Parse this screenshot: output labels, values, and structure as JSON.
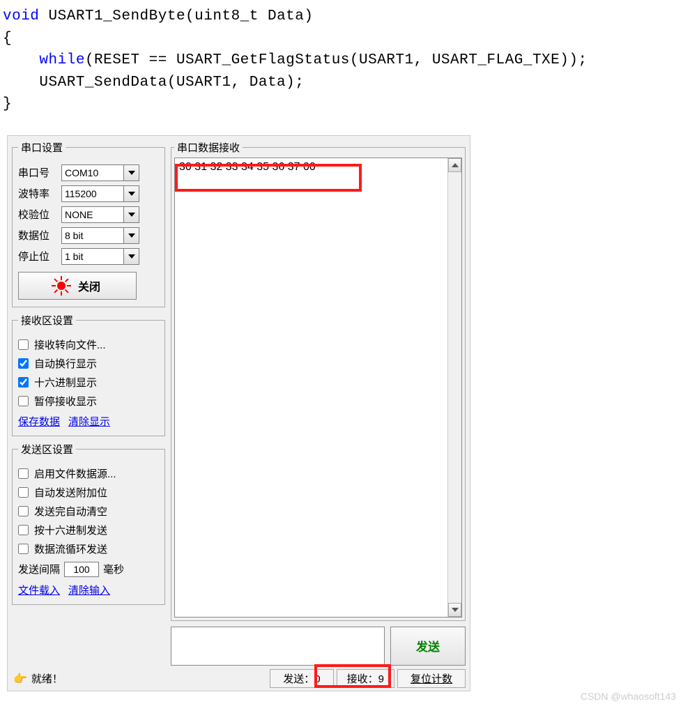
{
  "code": {
    "line1_kw": "void",
    "line1_rest": " USART1_SendByte(uint8_t Data)",
    "line2": "{",
    "line3_pre": "    ",
    "line3_kw": "while",
    "line3_rest": "(RESET == USART_GetFlagStatus(USART1, USART_FLAG_TXE));",
    "line4": "    USART_SendData(USART1, Data);",
    "line5": "}"
  },
  "serial_settings": {
    "legend": "串口设置",
    "port_label": "串口号",
    "port_value": "COM10",
    "baud_label": "波特率",
    "baud_value": "115200",
    "parity_label": "校验位",
    "parity_value": "NONE",
    "databits_label": "数据位",
    "databits_value": "8 bit",
    "stopbits_label": "停止位",
    "stopbits_value": "1 bit",
    "close_button": "关闭"
  },
  "rx_settings": {
    "legend": "接收区设置",
    "to_file": "接收转向文件...",
    "auto_wrap": "自动换行显示",
    "hex_display": "十六进制显示",
    "pause_rx": "暂停接收显示",
    "save_data": "保存数据",
    "clear_display": "清除显示"
  },
  "tx_settings": {
    "legend": "发送区设置",
    "use_file": "启用文件数据源...",
    "auto_send_append": "自动发送附加位",
    "auto_clear": "发送完自动清空",
    "hex_send": "按十六进制发送",
    "loop_send": "数据流循环发送",
    "interval_label": "发送间隔",
    "interval_value": "100",
    "interval_unit": "毫秒",
    "file_load": "文件载入",
    "clear_input": "清除输入"
  },
  "rx_area": {
    "legend": "串口数据接收",
    "content": "30 31 32 33 34 35 36 37 00"
  },
  "send": {
    "button": "发送"
  },
  "status": {
    "ready": "就绪！",
    "sent_label": "发送：0",
    "recv_label": "接收：9",
    "reset_label": "复位计数"
  },
  "watermark": "CSDN @whaosoft143"
}
